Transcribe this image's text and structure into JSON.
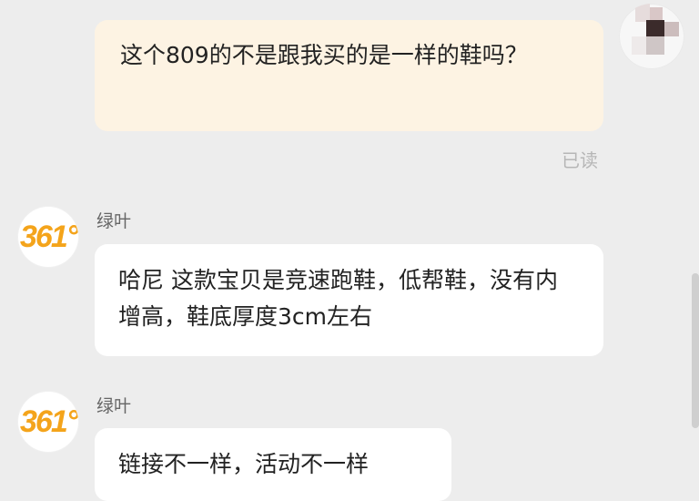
{
  "messages": [
    {
      "direction": "outgoing",
      "text": "这个809的不是跟我买的是一样的鞋吗？",
      "status": "已读"
    },
    {
      "direction": "incoming",
      "sender": "绿叶",
      "avatar_logo": "361°",
      "text": "哈尼 这款宝贝是竞速跑鞋，低帮鞋，没有内增高，鞋底厚度3cm左右"
    },
    {
      "direction": "incoming",
      "sender": "绿叶",
      "avatar_logo": "361°",
      "text": "链接不一样，活动不一样"
    }
  ],
  "colors": {
    "background": "#ededed",
    "outgoing_bubble": "#fdf3e3",
    "incoming_bubble": "#ffffff",
    "brand_logo": "#f4a41b",
    "read_status": "#b6b6b6"
  }
}
